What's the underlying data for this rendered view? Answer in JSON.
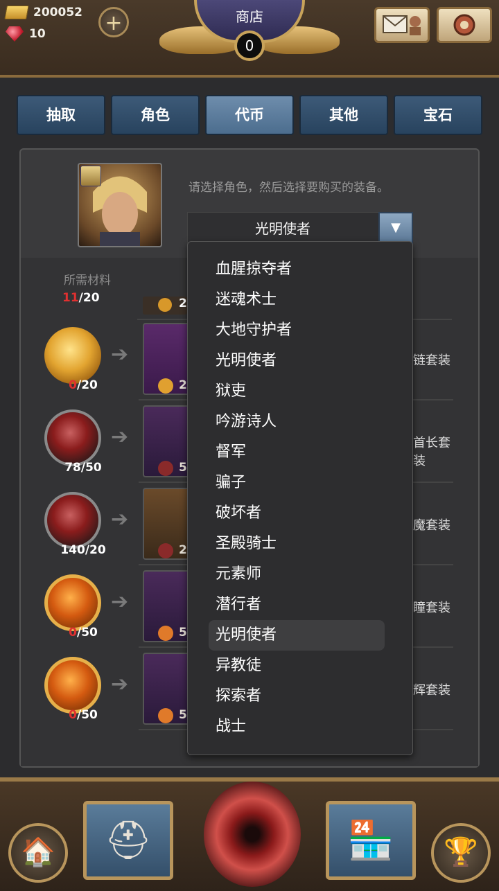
{
  "resources": {
    "gold": "200052",
    "gems": "10"
  },
  "header": {
    "title": "商店",
    "counter": "0"
  },
  "tabs": [
    {
      "label": "抽取"
    },
    {
      "label": "角色"
    },
    {
      "label": "代币"
    },
    {
      "label": "其他"
    },
    {
      "label": "宝石"
    }
  ],
  "active_tab": "代币",
  "character": {
    "hint": "请选择角色，然后选择要购买的装备。",
    "selected": "光明使者"
  },
  "materials": {
    "header": "所需材料",
    "partial_row": {
      "owned": "11",
      "required": "/20",
      "cost_prefix": "2"
    },
    "rows": [
      {
        "owned": "0",
        "required": "/20",
        "cost_prefix": "2",
        "set_suffix": "链套装"
      },
      {
        "owned": "78",
        "required": "/50",
        "cost_prefix": "5",
        "set_suffix": "首长套装"
      },
      {
        "owned": "140",
        "required": "/20",
        "cost_prefix": "2",
        "set_suffix": "魔套装"
      },
      {
        "owned": "0",
        "required": "/50",
        "cost_prefix": "5",
        "set_suffix": "瞳套装"
      },
      {
        "owned": "0",
        "required": "/50",
        "cost_prefix": "5",
        "set_suffix": "辉套装"
      }
    ]
  },
  "dropdown_options": [
    "血腥掠夺者",
    "迷魂术士",
    "大地守护者",
    "光明使者",
    "狱吏",
    "吟游诗人",
    "督军",
    "骗子",
    "破坏者",
    "圣殿骑士",
    "元素师",
    "潜行者",
    "光明使者",
    "异教徒",
    "探索者",
    "战士"
  ],
  "dropdown_selected_index": 12,
  "colors": {
    "tab": "#28435e",
    "tab_active": "#6e8dac",
    "negative": "#e03030",
    "gold": "#c8a35a"
  },
  "icons": [
    "gold-bar-icon",
    "ruby-icon",
    "plus-icon",
    "mail-icon",
    "settings-icon",
    "dropdown-arrow-icon",
    "home-icon",
    "helmet-icon",
    "portal-icon",
    "market-icon",
    "trophy-icon"
  ]
}
